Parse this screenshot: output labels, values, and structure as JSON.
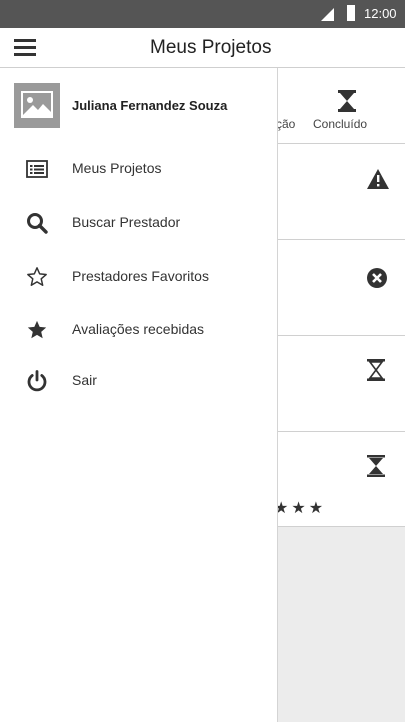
{
  "status_bar": {
    "time": "12:00"
  },
  "app_bar": {
    "title": "Meus Projetos",
    "menu_icon": "hamburger-menu-icon"
  },
  "drawer": {
    "user_name": "Juliana Fernandez Souza",
    "avatar_icon": "image-placeholder-icon",
    "items": [
      {
        "label": "Meus Projetos",
        "icon": "list-icon"
      },
      {
        "label": "Buscar Prestador",
        "icon": "search-icon"
      },
      {
        "label": "Prestadores Favoritos",
        "icon": "star-outline-icon"
      },
      {
        "label": "Avaliações recebidas",
        "icon": "star-filled-icon"
      },
      {
        "label": "Sair",
        "icon": "power-icon"
      }
    ]
  },
  "background": {
    "tabs": {
      "partial_label": "ção",
      "concluido_label": "Concluído"
    },
    "cards": [
      {
        "icon": "warning-icon"
      },
      {
        "icon": "cancel-circle-icon"
      },
      {
        "icon": "hourglass-outline-icon"
      },
      {
        "icon": "hourglass-filled-icon",
        "rating_stars": 3
      }
    ]
  },
  "colors": {
    "status_bar": "#555555",
    "avatar_bg": "#9a9a9a",
    "text": "#333333",
    "grey_area": "#ececec"
  }
}
